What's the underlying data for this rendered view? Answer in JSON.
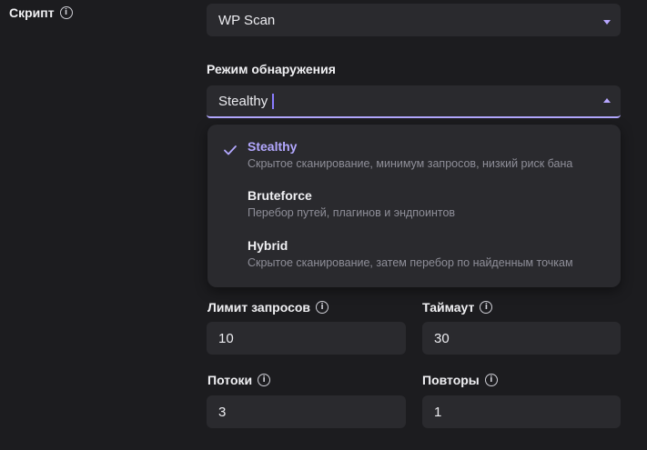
{
  "script": {
    "label": "Скрипт",
    "value": "WP Scan"
  },
  "detection_mode": {
    "label": "Режим обнаружения",
    "value": "Stealthy",
    "options": [
      {
        "title": "Stealthy",
        "desc": "Скрытое сканирование, минимум запросов, низкий риск бана",
        "selected": true
      },
      {
        "title": "Bruteforce",
        "desc": "Перебор путей, плагинов и эндпоинтов",
        "selected": false
      },
      {
        "title": "Hybrid",
        "desc": "Скрытое сканирование, затем перебор по найденным точкам",
        "selected": false
      }
    ]
  },
  "request_limit": {
    "label": "Лимит запросов",
    "value": "10"
  },
  "timeout": {
    "label": "Таймаут",
    "value": "30"
  },
  "threads": {
    "label": "Потоки",
    "value": "3"
  },
  "retries": {
    "label": "Повторы",
    "value": "1"
  },
  "colors": {
    "background": "#1c1c1f",
    "field": "#2a2a2e",
    "accent": "#b3a8ff"
  }
}
